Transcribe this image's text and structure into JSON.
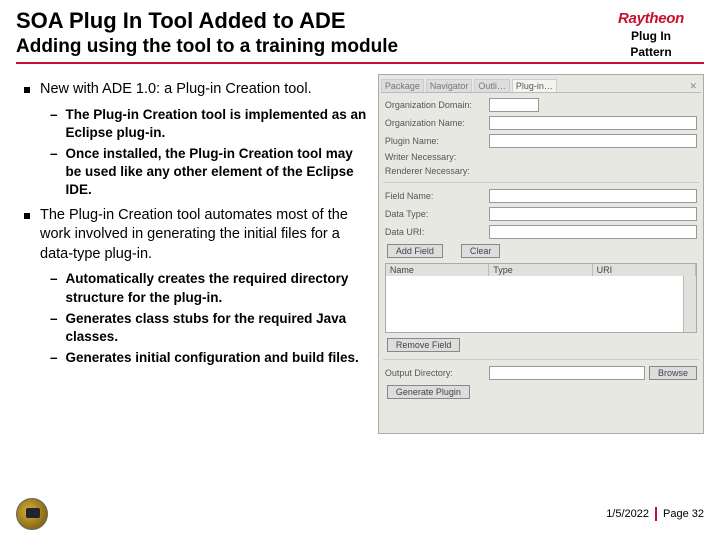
{
  "header": {
    "title": "SOA Plug In Tool Added to ADE",
    "subtitle": "Adding using the tool to a training module",
    "brand": "Raytheon",
    "pattern_line1": "Plug In",
    "pattern_line2": "Pattern"
  },
  "bullets": [
    {
      "text": "New with ADE 1.0: a Plug-in Creation tool.",
      "subs": [
        "The Plug-in Creation tool is implemented as an Eclipse plug-in.",
        "Once installed, the Plug-in Creation tool may be used like any other element of the Eclipse IDE."
      ]
    },
    {
      "text": "The Plug-in Creation tool automates most of the work involved in generating the initial files for a data-type plug-in.",
      "subs": [
        "Automatically creates the required directory structure for the plug-in.",
        "Generates class stubs for the required Java classes.",
        "Generates initial configuration and build files."
      ]
    }
  ],
  "panel": {
    "tabs": [
      "Package",
      "Navigator",
      "Outli…",
      "Plug-in…"
    ],
    "fields": {
      "org_domain": "Organization Domain:",
      "org_name": "Organization Name:",
      "plugin_name": "Plugin Name:",
      "writer_necessary": "Writer Necessary:",
      "renderer_necessary": "Renderer Necessary:",
      "field_name": "Field Name:",
      "data_type": "Data Type:",
      "data_uri": "Data URI:",
      "output_dir": "Output Directory:"
    },
    "buttons": {
      "add_field": "Add Field",
      "clear": "Clear",
      "remove_field": "Remove Field",
      "browse": "Browse",
      "generate": "Generate Plugin"
    },
    "grid_headers": [
      "Name",
      "Type",
      "URI"
    ]
  },
  "footer": {
    "date": "1/5/2022",
    "page": "Page 32"
  }
}
